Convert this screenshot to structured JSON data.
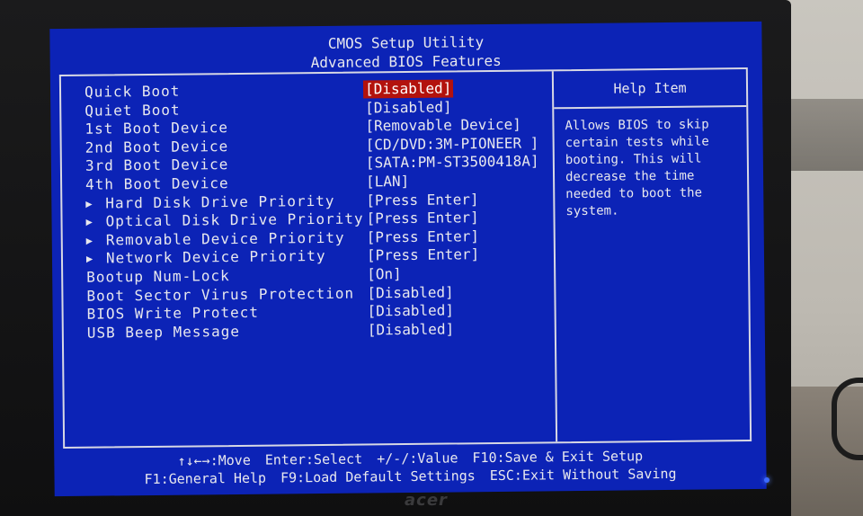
{
  "screen": {
    "title": "CMOS Setup Utility",
    "subtitle": "Advanced BIOS Features"
  },
  "settings": [
    {
      "label": "Quick Boot",
      "value": "[Disabled]",
      "submenu": false,
      "selected": true
    },
    {
      "label": "Quiet Boot",
      "value": "[Disabled]",
      "submenu": false,
      "selected": false
    },
    {
      "label": "1st Boot Device",
      "value": "[Removable Device]",
      "submenu": false,
      "selected": false
    },
    {
      "label": "2nd Boot Device",
      "value": "[CD/DVD:3M-PIONEER ]",
      "submenu": false,
      "selected": false
    },
    {
      "label": "3rd Boot Device",
      "value": "[SATA:PM-ST3500418A]",
      "submenu": false,
      "selected": false
    },
    {
      "label": "4th Boot Device",
      "value": "[LAN]",
      "submenu": false,
      "selected": false
    },
    {
      "label": "Hard Disk Drive Priority",
      "value": "[Press Enter]",
      "submenu": true,
      "selected": false
    },
    {
      "label": "Optical Disk Drive Priority",
      "value": "[Press Enter]",
      "submenu": true,
      "selected": false
    },
    {
      "label": "Removable Device Priority",
      "value": "[Press Enter]",
      "submenu": true,
      "selected": false
    },
    {
      "label": "Network Device Priority",
      "value": "[Press Enter]",
      "submenu": true,
      "selected": false
    },
    {
      "label": "Bootup Num-Lock",
      "value": "[On]",
      "submenu": false,
      "selected": false
    },
    {
      "label": "Boot Sector Virus Protection",
      "value": "[Disabled]",
      "submenu": false,
      "selected": false
    },
    {
      "label": "BIOS Write Protect",
      "value": "[Disabled]",
      "submenu": false,
      "selected": false
    },
    {
      "label": "USB Beep Message",
      "value": "[Disabled]",
      "submenu": false,
      "selected": false
    }
  ],
  "submenu_marker": "▶",
  "help": {
    "title": "Help Item",
    "text": "Allows BIOS to skip\ncertain tests while\nbooting. This will\ndecrease the time\nneeded to boot the\nsystem."
  },
  "footer": {
    "line1": [
      "↑↓←→:Move",
      "Enter:Select",
      "+/-/:Value",
      "F10:Save & Exit Setup"
    ],
    "line2": [
      "F1:General Help",
      "F9:Load Default Settings",
      "ESC:Exit Without Saving"
    ]
  },
  "monitor": {
    "brand": "acer"
  },
  "colors": {
    "screen_bg": "#0c23b6",
    "text": "#e8e8ee",
    "selected_bg": "#b3120d"
  }
}
